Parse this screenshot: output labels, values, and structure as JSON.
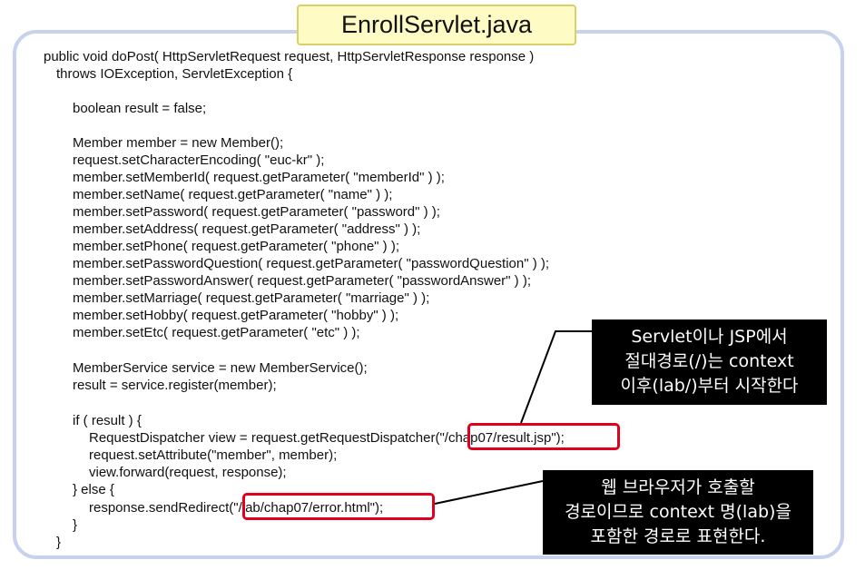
{
  "title": "EnrollServlet.java",
  "code_lines": [
    "public void doPost( HttpServletRequest request, HttpServletResponse response )",
    "throws IOException, ServletException {",
    "boolean result = false;",
    "Member member = new Member();",
    "request.setCharacterEncoding( \"euc-kr\" );",
    "member.setMemberId( request.getParameter( \"memberId\" ) );",
    "member.setName( request.getParameter( \"name\" ) );",
    "member.setPassword( request.getParameter( \"password\" ) );",
    "member.setAddress( request.getParameter( \"address\" ) );",
    "member.setPhone( request.getParameter( \"phone\" ) );",
    "member.setPasswordQuestion( request.getParameter( \"passwordQuestion\" ) );",
    "member.setPasswordAnswer( request.getParameter( \"passwordAnswer\" ) );",
    "member.setMarriage( request.getParameter( \"marriage\" ) );",
    "member.setHobby( request.getParameter( \"hobby\" ) );",
    "member.setEtc( request.getParameter( \"etc\" ) );",
    "MemberService service = new MemberService();",
    "result = service.register(member);",
    "if ( result ) {",
    "RequestDispatcher view = request.getRequestDispatcher(\"/chap07/result.jsp\");",
    "request.setAttribute(\"member\", member);",
    "view.forward(request, response);",
    "} else {",
    "response.sendRedirect(\"/lab/chap07/error.html\");",
    "}",
    "}"
  ],
  "callouts": {
    "absolute_path": [
      "Servlet이나 JSP에서",
      "절대경로(/)는 context",
      "이후(lab/)부터 시작한다"
    ],
    "browser_path": [
      "웹 브라우저가 호출할",
      "경로이므로 context 명(lab)을",
      "포함한 경로로 표현한다."
    ]
  },
  "colors": {
    "frame_border": "#c7d3ec",
    "title_background": "#fefcc4",
    "highlight": "#e0001b",
    "callout_background": "#000000"
  }
}
